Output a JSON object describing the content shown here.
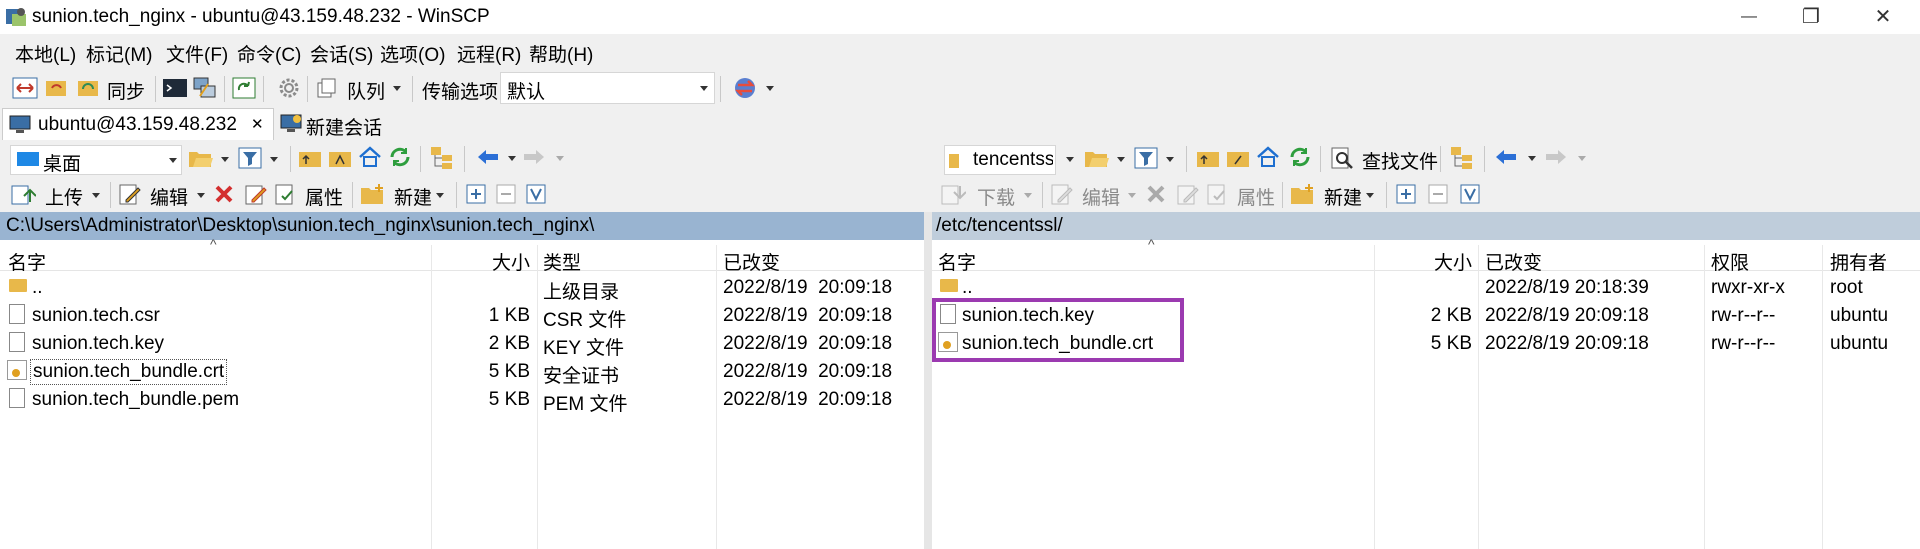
{
  "window": {
    "title": "sunion.tech_nginx - ubuntu@43.159.48.232 - WinSCP",
    "minimize": "—",
    "restore": "❐",
    "close": "✕"
  },
  "menu": [
    {
      "label": "本地(L)"
    },
    {
      "label": "标记(M)"
    },
    {
      "label": "文件(F)"
    },
    {
      "label": "命令(C)"
    },
    {
      "label": "会话(S)"
    },
    {
      "label": "选项(O)"
    },
    {
      "label": "远程(R)"
    },
    {
      "label": "帮助(H)"
    }
  ],
  "toolbar": {
    "sync_label": "同步",
    "queue_label": "队列",
    "transfer_options_label": "传输选项",
    "transfer_preset": "默认"
  },
  "tabs": {
    "session_label": "ubuntu@43.159.48.232",
    "close_glyph": "✕",
    "new_session_label": "新建会话"
  },
  "local": {
    "location": "桌面",
    "upload_label": "上传",
    "edit_label": "编辑",
    "properties_label": "属性",
    "new_label": "新建",
    "path": "C:\\Users\\Administrator\\Desktop\\sunion.tech_nginx\\sunion.tech_nginx\\",
    "columns": {
      "name": "名字",
      "size": "大小",
      "type": "类型",
      "changed": "已改变"
    },
    "files": [
      {
        "name": "..",
        "size": "",
        "type": "上级目录",
        "changed": "2022/8/19  20:09:18",
        "icon": "parent-folder-icon"
      },
      {
        "name": "sunion.tech.csr",
        "size": "1 KB",
        "type": "CSR 文件",
        "changed": "2022/8/19  20:09:18",
        "icon": "file-icon"
      },
      {
        "name": "sunion.tech.key",
        "size": "2 KB",
        "type": "KEY 文件",
        "changed": "2022/8/19  20:09:18",
        "icon": "file-icon"
      },
      {
        "name": "sunion.tech_bundle.crt",
        "size": "5 KB",
        "type": "安全证书",
        "changed": "2022/8/19  20:09:18",
        "icon": "certificate-icon"
      },
      {
        "name": "sunion.tech_bundle.pem",
        "size": "5 KB",
        "type": "PEM 文件",
        "changed": "2022/8/19  20:09:18",
        "icon": "file-icon"
      }
    ]
  },
  "remote": {
    "location": "tencentssl",
    "find_files_label": "查找文件",
    "download_label": "下载",
    "edit_label": "编辑",
    "properties_label": "属性",
    "new_label": "新建",
    "path": "/etc/tencentssl/",
    "columns": {
      "name": "名字",
      "size": "大小",
      "changed": "已改变",
      "rights": "权限",
      "owner": "拥有者"
    },
    "files": [
      {
        "name": "..",
        "size": "",
        "changed": "2022/8/19 20:18:39",
        "rights": "rwxr-xr-x",
        "owner": "root",
        "icon": "parent-folder-icon"
      },
      {
        "name": "sunion.tech.key",
        "size": "2 KB",
        "changed": "2022/8/19 20:09:18",
        "rights": "rw-r--r--",
        "owner": "ubuntu",
        "icon": "file-icon"
      },
      {
        "name": "sunion.tech_bundle.crt",
        "size": "5 KB",
        "changed": "2022/8/19 20:09:18",
        "rights": "rw-r--r--",
        "owner": "ubuntu",
        "icon": "certificate-icon"
      }
    ]
  },
  "colors": {
    "local_path_bg": "#99b4d1",
    "remote_path_bg": "#bfcddb",
    "highlight": "#9b3ab0"
  }
}
